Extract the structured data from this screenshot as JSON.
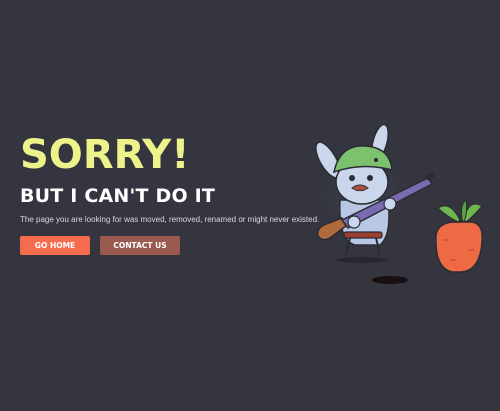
{
  "error": {
    "headline": "SORRY!",
    "subheadline": "BUT I CAN'T DO IT",
    "message": "The page you are looking for was moved, removed, renamed or might never existed."
  },
  "buttons": {
    "home_label": "GO HOME",
    "contact_label": "CONTACT US"
  },
  "colors": {
    "background": "#34353f",
    "headline": "#edf38a",
    "primary_button": "#f56b4e",
    "secondary_button": "#9a5a4f"
  },
  "illustration": {
    "icon": "bunny-with-shotgun-and-carrot-illustration"
  }
}
